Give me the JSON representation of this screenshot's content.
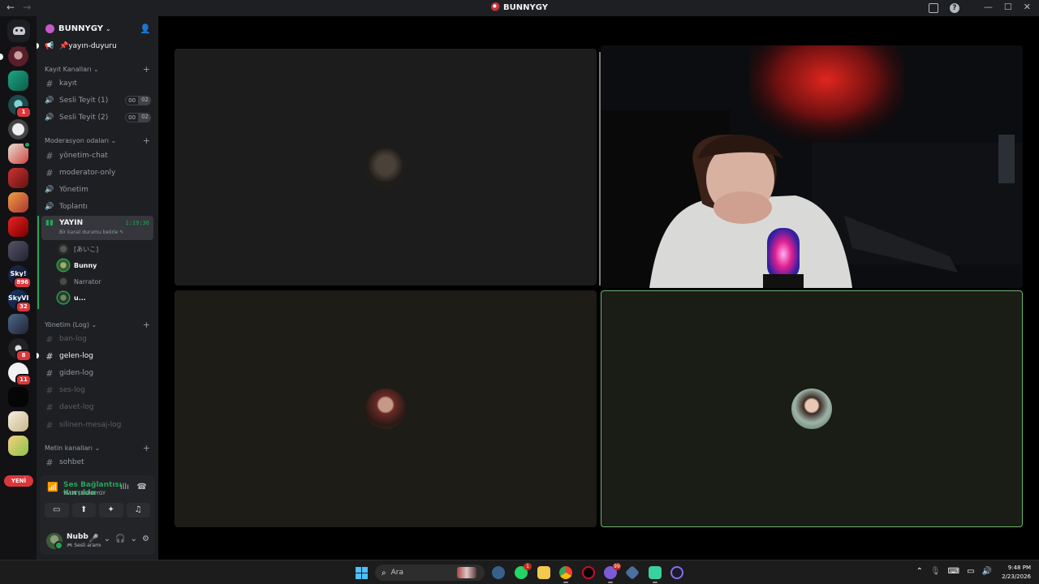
{
  "titlebar": {
    "back": "←",
    "forward": "→",
    "server_name": "BUNNYGY",
    "inbox_icon": "inbox-icon",
    "help": "?",
    "minimize": "—",
    "maximize": "☐",
    "close": "✕"
  },
  "rail": {
    "badges": [
      "1",
      "896",
      "32",
      "8",
      "11"
    ],
    "labels": [
      "Sky!",
      "SkyVI"
    ],
    "new_label": "YENİ"
  },
  "sidebar": {
    "server_name": "BUNNYGY",
    "top_channel": "📌yayın-duyuru",
    "categories": {
      "kayit": "Kayıt Kanalları",
      "moderasyon": "Moderasyon odaları",
      "yonetim_log": "Yönetim (Log)",
      "metin": "Metin kanalları"
    },
    "channels": {
      "kayit": "kayıt",
      "sesli_teyit_1": "Sesli Teyit (1)",
      "sesli_teyit_2": "Sesli Teyit (2)",
      "yonetim_chat": "yönetim-chat",
      "moderator_only": "moderator-only",
      "yonetim": "Yönetim",
      "toplanti": "Toplantı",
      "yayin": "YAYIN",
      "ban_log": "ban-log",
      "gelen_log": "gelen-log",
      "giden_log": "giden-log",
      "ses_log": "ses-log",
      "davet_log": "davet-log",
      "silinen_mesaj_log": "silinen-mesaj-log",
      "sohbet": "sohbet"
    },
    "teyit_counts": [
      "00",
      "02"
    ],
    "yayin_time": "1:19:36",
    "yayin_status": "Bir kanal durumu belirle ✎",
    "voice_users": [
      "[あいこ]",
      "Bunny",
      "Narrator",
      "u..."
    ]
  },
  "voice_panel": {
    "status": "Ses Bağlantısı Kuruldu",
    "location": "YAYIN / BUNNYGY"
  },
  "user_panel": {
    "name": "Nubb",
    "status": "🎮 Sesli aramı"
  },
  "taskbar": {
    "search_placeholder": "Ara",
    "badges": [
      "1",
      "99"
    ],
    "time": "9:48 PM",
    "date": "2/23/2026"
  },
  "colors": {
    "accent_green": "#23a559",
    "speaking_border": "#6fb36f",
    "badge_red": "#da373c"
  }
}
